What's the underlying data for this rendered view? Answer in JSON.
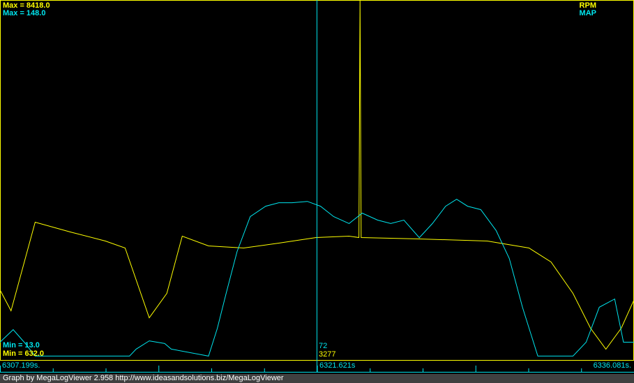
{
  "chart_data": {
    "type": "line",
    "xlim": [
      6307.199,
      6336.081
    ],
    "x_labels": {
      "start": "6307.199s.",
      "cursor": "6321.621s",
      "end": "6336.081s."
    },
    "cursor_time": 6321.621,
    "series": [
      {
        "name": "RPM",
        "color": "#ffff00",
        "min": 632.0,
        "max": 8418.0,
        "min_label": "Min = 632.0",
        "max_label": "Max = 8418.0",
        "cursor_value": "3277",
        "t": [
          6307.2,
          6307.7,
          6308.8,
          6310.4,
          6312.0,
          6312.9,
          6314.0,
          6314.8,
          6315.5,
          6316.7,
          6318.3,
          6319.9,
          6321.6,
          6323.1,
          6323.55,
          6323.6,
          6323.65,
          6326.3,
          6329.4,
          6331.3,
          6332.3,
          6333.3,
          6334.1,
          6334.8,
          6335.5,
          6336.1
        ],
        "values": [
          2156,
          1703,
          3620,
          3409,
          3212,
          3061,
          1552,
          2081,
          3318,
          3107,
          3061,
          3167,
          3288,
          3318,
          3288,
          8418,
          3288,
          3258,
          3212,
          3061,
          2760,
          2081,
          1326,
          873,
          1326,
          1960
        ]
      },
      {
        "name": "MAP",
        "color": "#00e5ee",
        "min": 13.0,
        "max": 148.0,
        "min_label": "Min = 13.0",
        "max_label": "Max = 148.0",
        "cursor_value": "72",
        "t": [
          6307.2,
          6307.8,
          6308.3,
          6308.8,
          6309.7,
          6313.1,
          6313.4,
          6314.0,
          6314.7,
          6315.0,
          6316.7,
          6317.1,
          6317.5,
          6318.0,
          6318.6,
          6319.3,
          6319.9,
          6320.5,
          6321.2,
          6321.8,
          6322.4,
          6323.1,
          6323.7,
          6324.4,
          6325.0,
          6325.6,
          6326.3,
          6326.9,
          6327.5,
          6328.0,
          6328.5,
          6329.1,
          6329.8,
          6330.4,
          6331.0,
          6331.7,
          6333.3,
          6333.9,
          6334.5,
          6335.2,
          6335.6,
          6336.1
        ],
        "values": [
          19.8,
          24.5,
          19.8,
          14.6,
          14.6,
          14.6,
          17.2,
          20.3,
          19.3,
          17.2,
          14.6,
          25,
          38.1,
          53.8,
          66.9,
          70.8,
          72.1,
          72.1,
          72.6,
          70.8,
          66.9,
          64.3,
          68.2,
          65.6,
          64.3,
          65.6,
          59,
          64.3,
          70.8,
          73.4,
          70.8,
          69.5,
          61.7,
          51.2,
          32.9,
          14.6,
          14.6,
          19.8,
          32.9,
          36,
          19.8,
          19.8
        ]
      }
    ]
  },
  "footer": "Graph by MegaLogViewer 2.958 http://www.ideasandsolutions.biz/MegaLogViewer"
}
